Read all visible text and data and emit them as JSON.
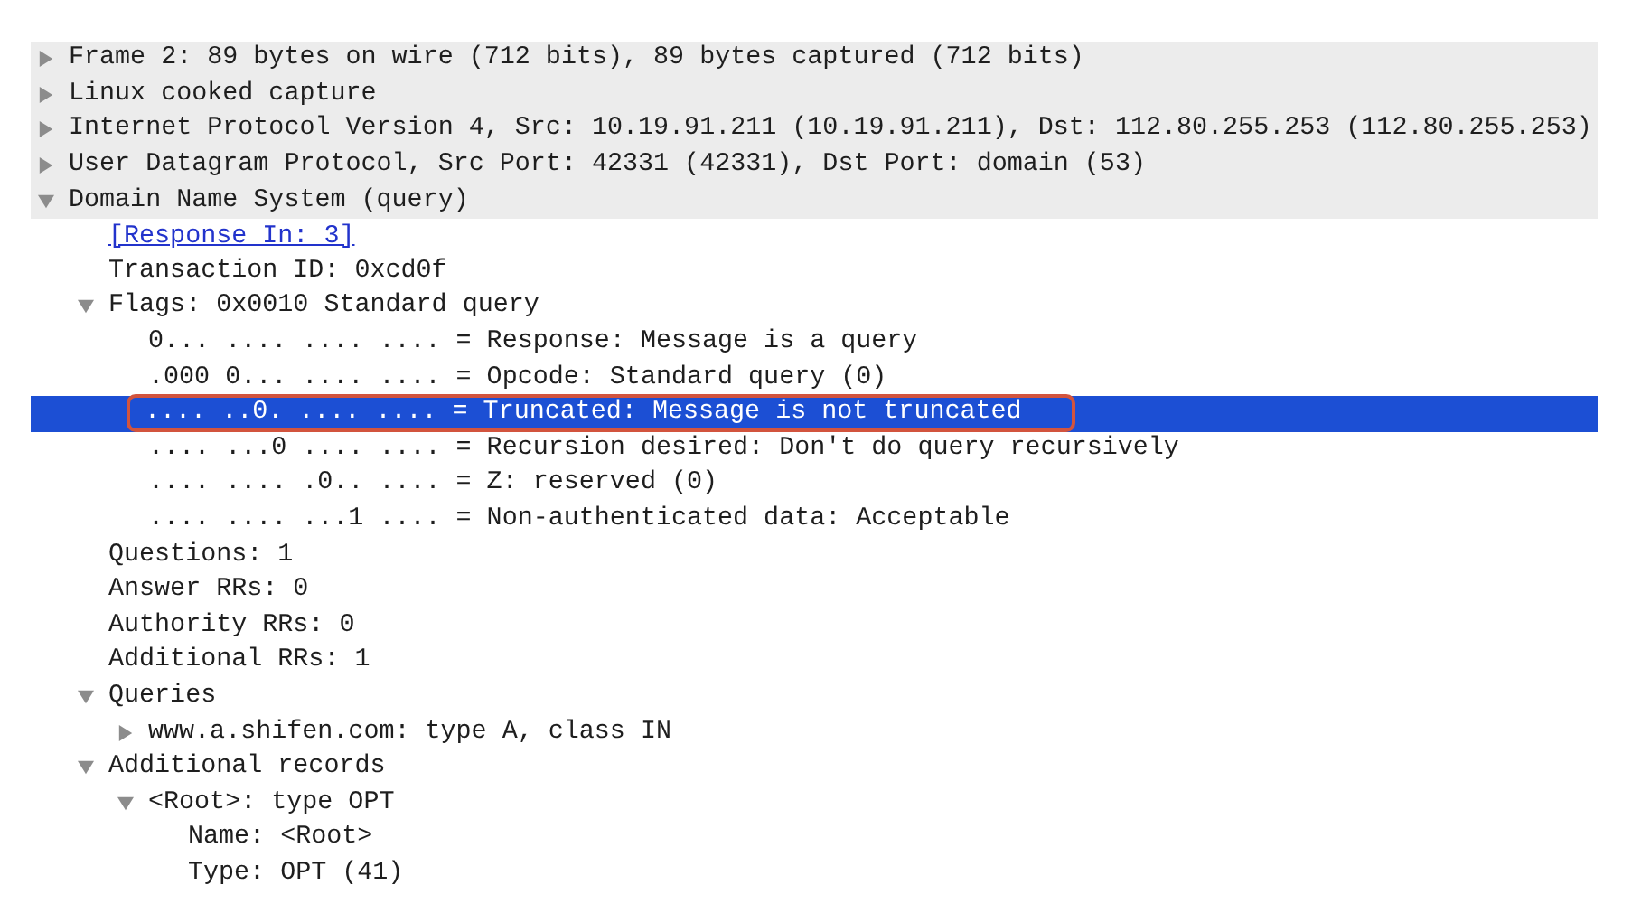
{
  "tree": [
    {
      "label": "Frame 2: 89 bytes on wire (712 bits), 89 bytes captured (712 bits)",
      "kind": "text",
      "expanded": false,
      "selected": false
    },
    {
      "label": "Linux cooked capture",
      "kind": "text",
      "expanded": false,
      "selected": false
    },
    {
      "label": "Internet Protocol Version 4, Src: 10.19.91.211 (10.19.91.211), Dst: 112.80.255.253 (112.80.255.253)",
      "kind": "text",
      "expanded": false,
      "selected": false
    },
    {
      "label": "User Datagram Protocol, Src Port: 42331 (42331), Dst Port: domain (53)",
      "kind": "text",
      "expanded": false,
      "selected": false
    },
    {
      "label": "Domain Name System (query)",
      "kind": "text",
      "expanded": true,
      "selected": false,
      "children": [
        {
          "label": "[Response In: 3]",
          "kind": "link",
          "selected": false
        },
        {
          "label": "Transaction ID: 0xcd0f",
          "kind": "text",
          "selected": false
        },
        {
          "label": "Flags: 0x0010 Standard query",
          "kind": "text",
          "expanded": true,
          "selected": false,
          "children": [
            {
              "label": "0... .... .... .... = Response: Message is a query",
              "kind": "text",
              "selected": false,
              "circled": false
            },
            {
              "label": ".000 0... .... .... = Opcode: Standard query (0)",
              "kind": "text",
              "selected": false,
              "circled": false
            },
            {
              "label": ".... ..0. .... .... = Truncated: Message is not truncated",
              "kind": "text",
              "selected": true,
              "circled": true
            },
            {
              "label": ".... ...0 .... .... = Recursion desired: Don't do query recursively",
              "kind": "text",
              "selected": false,
              "circled": false
            },
            {
              "label": ".... .... .0.. .... = Z: reserved (0)",
              "kind": "text",
              "selected": false,
              "circled": false
            },
            {
              "label": ".... .... ...1 .... = Non-authenticated data: Acceptable",
              "kind": "text",
              "selected": false,
              "circled": false
            }
          ]
        },
        {
          "label": "Questions: 1",
          "kind": "text",
          "selected": false
        },
        {
          "label": "Answer RRs: 0",
          "kind": "text",
          "selected": false
        },
        {
          "label": "Authority RRs: 0",
          "kind": "text",
          "selected": false
        },
        {
          "label": "Additional RRs: 1",
          "kind": "text",
          "selected": false
        },
        {
          "label": "Queries",
          "kind": "text",
          "expanded": true,
          "selected": false,
          "children": [
            {
              "label": "www.a.shifen.com: type A, class IN",
              "kind": "text",
              "expanded": false,
              "selected": false
            }
          ]
        },
        {
          "label": "Additional records",
          "kind": "text",
          "expanded": true,
          "selected": false,
          "children": [
            {
              "label": "<Root>: type OPT",
              "kind": "text",
              "expanded": true,
              "selected": false,
              "children": [
                {
                  "label": "Name: <Root>",
                  "kind": "text",
                  "selected": false
                },
                {
                  "label": "Type: OPT (41)",
                  "kind": "text",
                  "selected": false
                }
              ]
            }
          ]
        }
      ]
    }
  ]
}
